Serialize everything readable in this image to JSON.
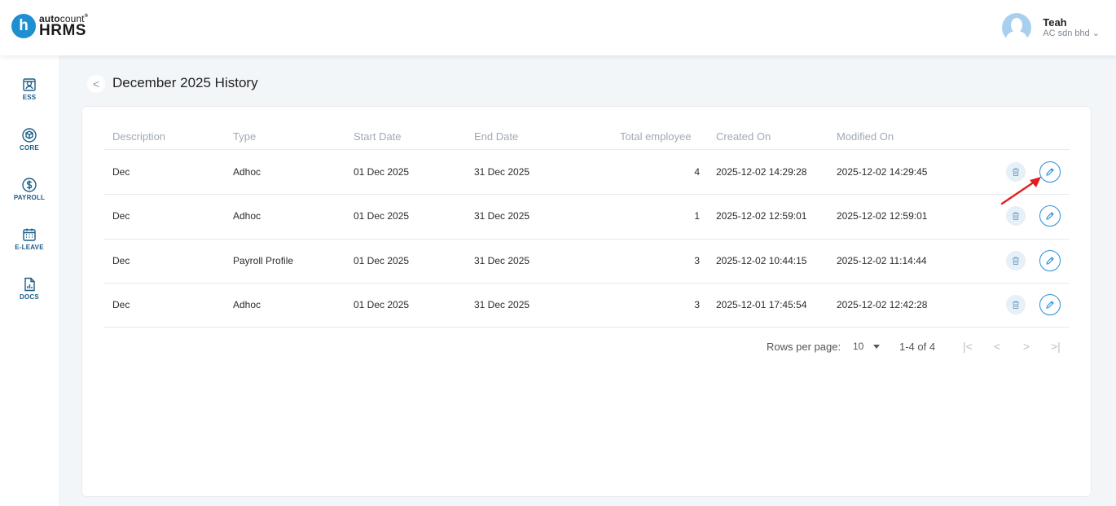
{
  "brand": {
    "logo_letter": "h",
    "auto": "auto",
    "count": "count",
    "mark": "®",
    "product": "HRMS"
  },
  "user": {
    "name": "Teah",
    "company": "AC sdn bhd ⌄"
  },
  "sidebar": {
    "items": [
      {
        "label": "ESS",
        "icon": "ess-icon"
      },
      {
        "label": "CORE",
        "icon": "cube-icon"
      },
      {
        "label": "PAYROLL",
        "icon": "dollar-icon"
      },
      {
        "label": "E-LEAVE",
        "icon": "calendar-icon"
      },
      {
        "label": "DOCS",
        "icon": "document-chart-icon"
      }
    ]
  },
  "page": {
    "back_symbol": "<",
    "title": "December 2025 History"
  },
  "table": {
    "headers": [
      "Description",
      "Type",
      "Start Date",
      "End Date",
      "Total employee",
      "Created On",
      "Modified On"
    ],
    "rows": [
      {
        "description": "Dec",
        "type": "Adhoc",
        "start": "01 Dec 2025",
        "end": "31 Dec 2025",
        "total": "4",
        "created": "2025-12-02 14:29:28",
        "modified": "2025-12-02 14:29:45"
      },
      {
        "description": "Dec",
        "type": "Adhoc",
        "start": "01 Dec 2025",
        "end": "31 Dec 2025",
        "total": "1",
        "created": "2025-12-02 12:59:01",
        "modified": "2025-12-02 12:59:01"
      },
      {
        "description": "Dec",
        "type": "Payroll Profile",
        "start": "01 Dec 2025",
        "end": "31 Dec 2025",
        "total": "3",
        "created": "2025-12-02 10:44:15",
        "modified": "2025-12-02 11:14:44"
      },
      {
        "description": "Dec",
        "type": "Adhoc",
        "start": "01 Dec 2025",
        "end": "31 Dec 2025",
        "total": "3",
        "created": "2025-12-01 17:45:54",
        "modified": "2025-12-02 12:42:28"
      }
    ]
  },
  "pagination": {
    "rows_per_page_label": "Rows per page:",
    "rows_per_page_value": "10",
    "range": "1-4 of 4",
    "first": "|<",
    "prev": "<",
    "next": ">",
    "last": ">|"
  },
  "colors": {
    "accent": "#2a8fd6",
    "sidebar_icon": "#1b5d86",
    "annotation_arrow": "#e02020"
  }
}
